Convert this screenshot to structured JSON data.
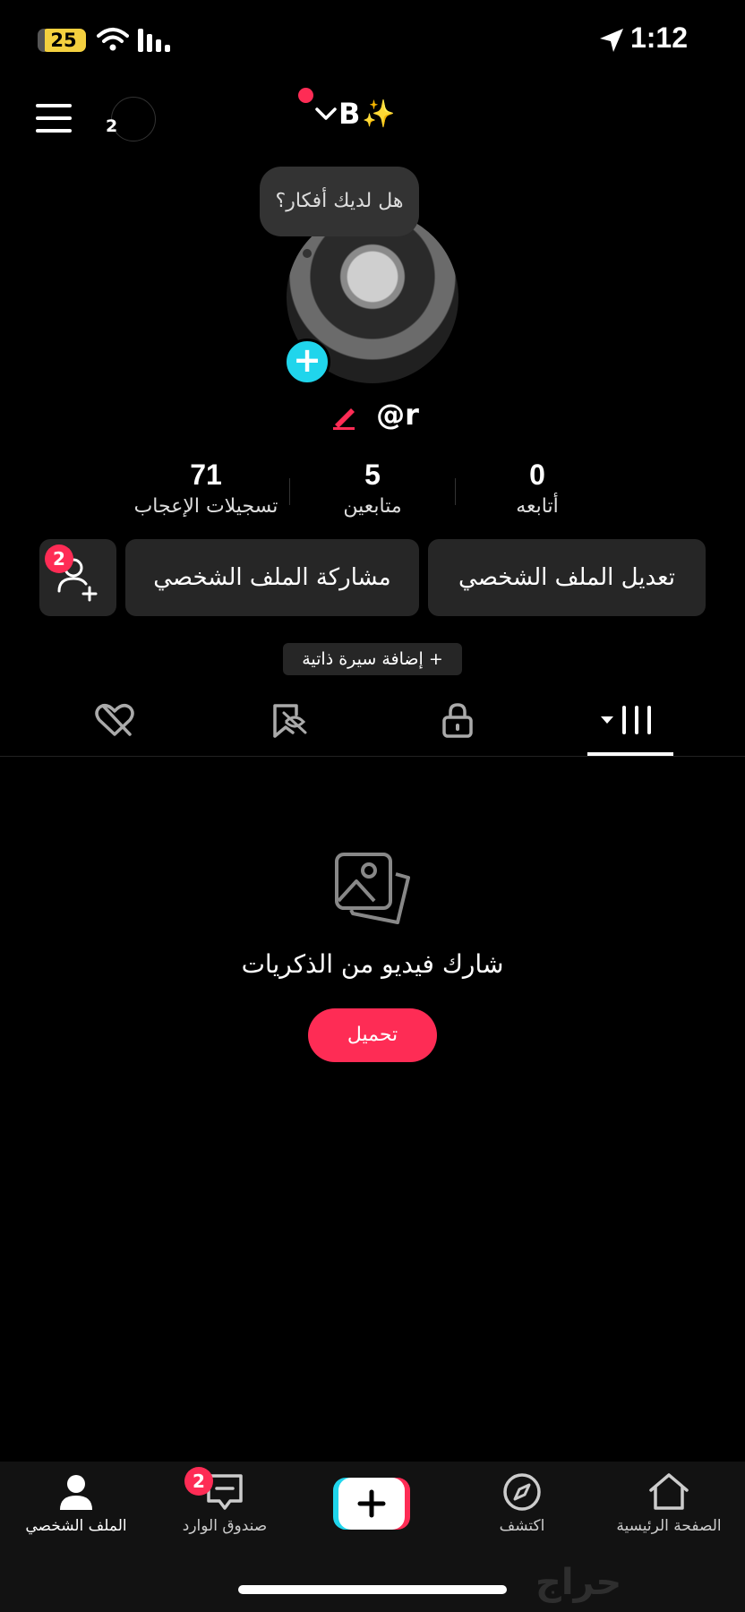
{
  "status_bar": {
    "battery": "25",
    "time": "1:12"
  },
  "header": {
    "avatar_count": "2",
    "account_name": "B",
    "account_emoji": "✨"
  },
  "tooltip": {
    "text": "هل لديك أفكار؟"
  },
  "profile": {
    "username": "@r"
  },
  "stats": [
    {
      "value": "71",
      "label": "تسجيلات الإعجاب"
    },
    {
      "value": "5",
      "label": "متابعين"
    },
    {
      "value": "0",
      "label": "أتابعه"
    }
  ],
  "buttons": {
    "edit_profile": "تعديل الملف الشخصي",
    "share_profile": "مشاركة الملف الشخصي",
    "add_friends_badge": "2"
  },
  "bio": {
    "add_bio": "+ إضافة سيرة ذاتية"
  },
  "empty_state": {
    "title": "شارك فيديو من الذكريات",
    "upload_label": "تحميل"
  },
  "bottom_nav": {
    "home": "الصفحة الرئيسية",
    "discover": "اكتشف",
    "inbox": "صندوق الوارد",
    "inbox_badge": "2",
    "profile": "الملف الشخصي"
  },
  "watermark": "حراج",
  "colors": {
    "accent": "#fe2c55",
    "cyan": "#20d5ec",
    "surface": "#262626"
  }
}
